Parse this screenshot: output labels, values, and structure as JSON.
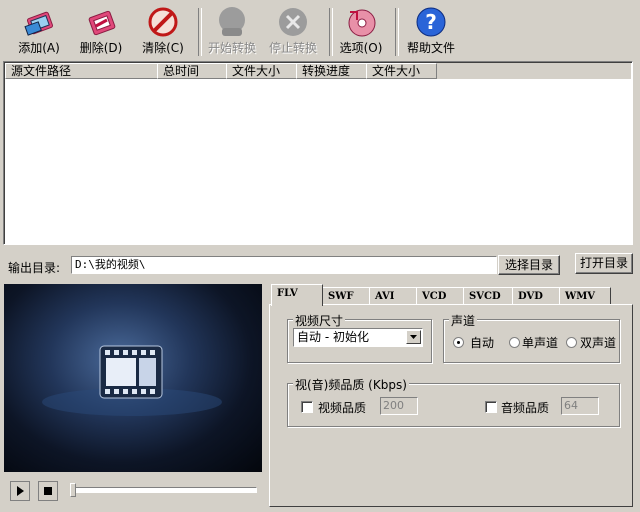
{
  "toolbar": {
    "add": "添加(A)",
    "delete": "删除(D)",
    "clear": "清除(C)",
    "start": "开始转换",
    "stop": "停止转换",
    "options": "选项(O)",
    "help": "帮助文件"
  },
  "file_list": {
    "columns": [
      "源文件路径",
      "总时间",
      "文件大小",
      "转换进度",
      "文件大小"
    ],
    "rows": []
  },
  "output": {
    "label": "输出目录:",
    "path": "D:\\我的视频\\",
    "select_dir": "选择目录",
    "open_dir": "打开目录"
  },
  "tabs": [
    "FLV",
    "SWF",
    "AVI",
    "VCD",
    "SVCD",
    "DVD",
    "WMV"
  ],
  "active_tab": "FLV",
  "flv": {
    "video_size_title": "视频尺寸",
    "video_size_value": "自动 - 初始化",
    "channel_title": "声道",
    "channel_options": [
      "自动",
      "单声道",
      "双声道"
    ],
    "channel_selected": "自动",
    "quality_title": "视(音)频品质 (Kbps)",
    "video_quality_label": "视频品质",
    "video_quality_value": "200",
    "audio_quality_label": "音频品质",
    "audio_quality_value": "64"
  },
  "player": {
    "progress": 0
  },
  "colors": {
    "window_bg": "#d4d0c8",
    "video_bg": "#0d1526"
  }
}
